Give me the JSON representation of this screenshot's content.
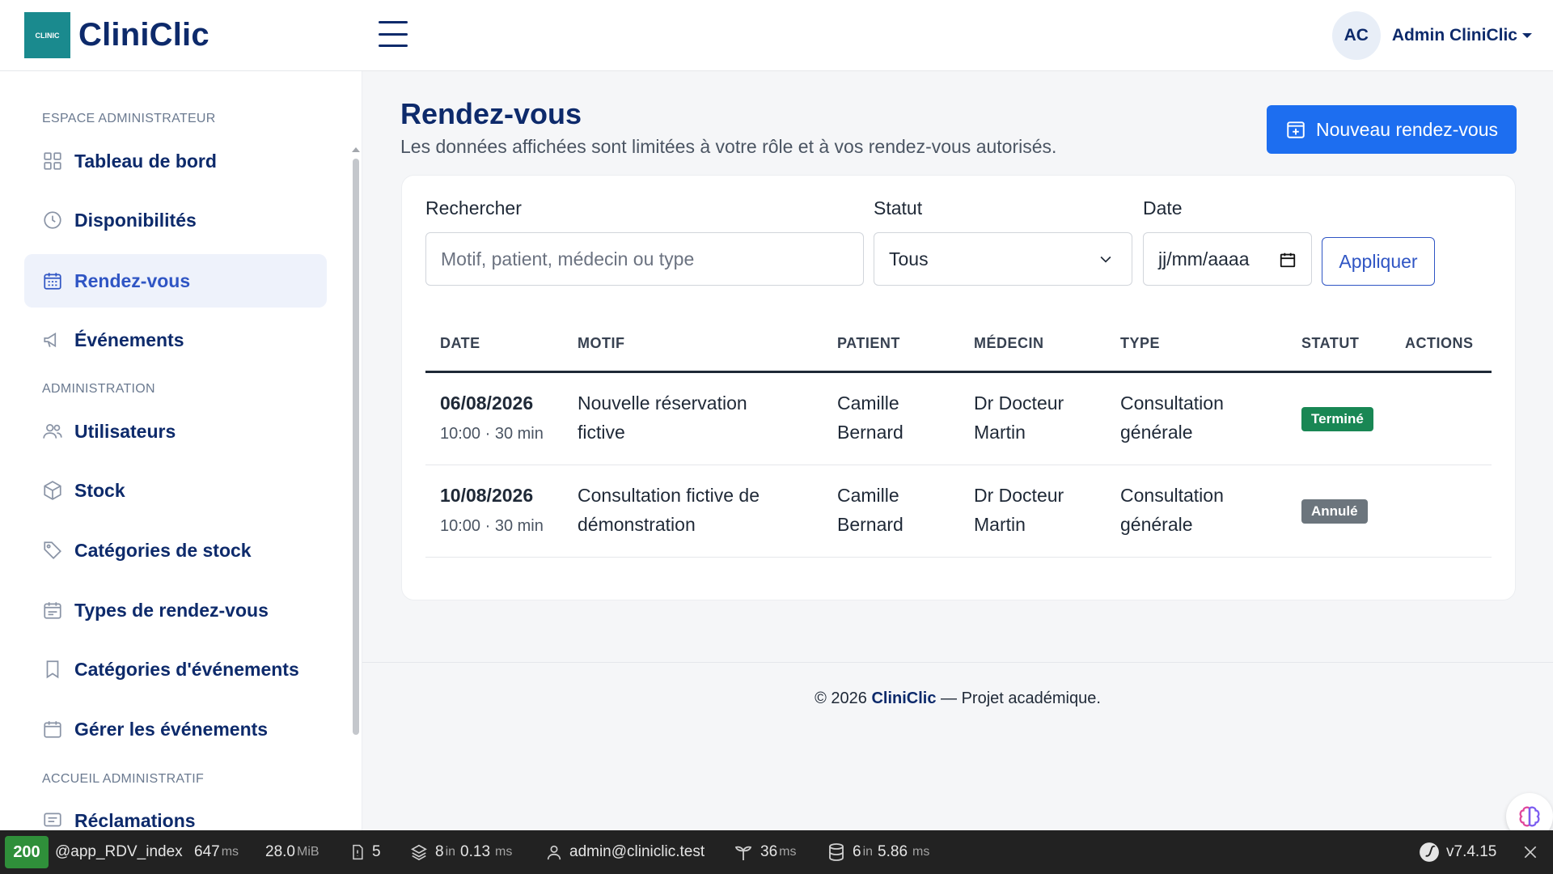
{
  "app": {
    "brand": "CliniClic",
    "logo_text": "CLINIC"
  },
  "user": {
    "initials": "AC",
    "name": "Admin CliniClic"
  },
  "sidebar": {
    "sections": [
      {
        "title": "ESPACE ADMINISTRATEUR"
      },
      {
        "title": "ADMINISTRATION"
      },
      {
        "title": "ACCUEIL ADMINISTRATIF"
      }
    ],
    "items": [
      {
        "label": "Tableau de bord",
        "icon": "grid-icon"
      },
      {
        "label": "Disponibilités",
        "icon": "clock-icon"
      },
      {
        "label": "Rendez-vous",
        "icon": "calendar-icon",
        "active": true
      },
      {
        "label": "Événements",
        "icon": "megaphone-icon"
      },
      {
        "label": "Utilisateurs",
        "icon": "users-icon"
      },
      {
        "label": "Stock",
        "icon": "box-icon"
      },
      {
        "label": "Catégories de stock",
        "icon": "tags-icon"
      },
      {
        "label": "Types de rendez-vous",
        "icon": "calendar-range-icon"
      },
      {
        "label": "Catégories d'événements",
        "icon": "bookmark-icon"
      },
      {
        "label": "Gérer les événements",
        "icon": "calendar-icon"
      },
      {
        "label": "Réclamations",
        "icon": "message-icon"
      }
    ]
  },
  "page": {
    "title": "Rendez-vous",
    "subtitle": "Les données affichées sont limitées à votre rôle et à vos rendez-vous autorisés.",
    "new_button": "Nouveau rendez-vous"
  },
  "filters": {
    "search_label": "Rechercher",
    "search_placeholder": "Motif, patient, médecin ou type",
    "status_label": "Statut",
    "status_value": "Tous",
    "date_label": "Date",
    "date_placeholder": "jj/mm/aaaa",
    "apply_button": "Appliquer"
  },
  "table": {
    "headers": [
      "DATE",
      "MOTIF",
      "PATIENT",
      "MÉDECIN",
      "TYPE",
      "STATUT",
      "ACTIONS"
    ],
    "rows": [
      {
        "date": "06/08/2026",
        "time": "10:00 · 30 min",
        "motif_line1": "Nouvelle réservation",
        "motif_line2": "fictive",
        "patient_line1": "Camille",
        "patient_line2": "Bernard",
        "medecin_line1": "Dr Docteur",
        "medecin_line2": "Martin",
        "type_line1": "Consultation",
        "type_line2": "générale",
        "status": "Terminé",
        "status_color": "#198754"
      },
      {
        "date": "10/08/2026",
        "time": "10:00 · 30 min",
        "motif_line1": "Consultation fictive de",
        "motif_line2": "démonstration",
        "patient_line1": "Camille",
        "patient_line2": "Bernard",
        "medecin_line1": "Dr Docteur",
        "medecin_line2": "Martin",
        "type_line1": "Consultation",
        "type_line2": "générale",
        "status": "Annulé",
        "status_color": "#6c757d"
      }
    ]
  },
  "footer": {
    "prefix": "© 2026 ",
    "brand": "CliniClic",
    "suffix": " — Projet académique."
  },
  "debug": {
    "status": "200",
    "route": "@app_RDV_index",
    "time_value": "647",
    "time_unit": "ms",
    "memory_value": "28.0",
    "memory_unit": "MiB",
    "forms_count": "5",
    "cache_count": "8",
    "cache_in": "in",
    "cache_time": "0.13",
    "cache_unit": "ms",
    "user": "admin@cliniclic.test",
    "twig_time": "36",
    "twig_unit": "ms",
    "db_count": "6",
    "db_in": "in",
    "db_time": "5.86",
    "db_unit": "ms",
    "version": "v7.4.15"
  },
  "colors": {
    "primary": "#1d6ef0",
    "navy": "#0d2a6b",
    "active_bg": "#eef2fb"
  }
}
